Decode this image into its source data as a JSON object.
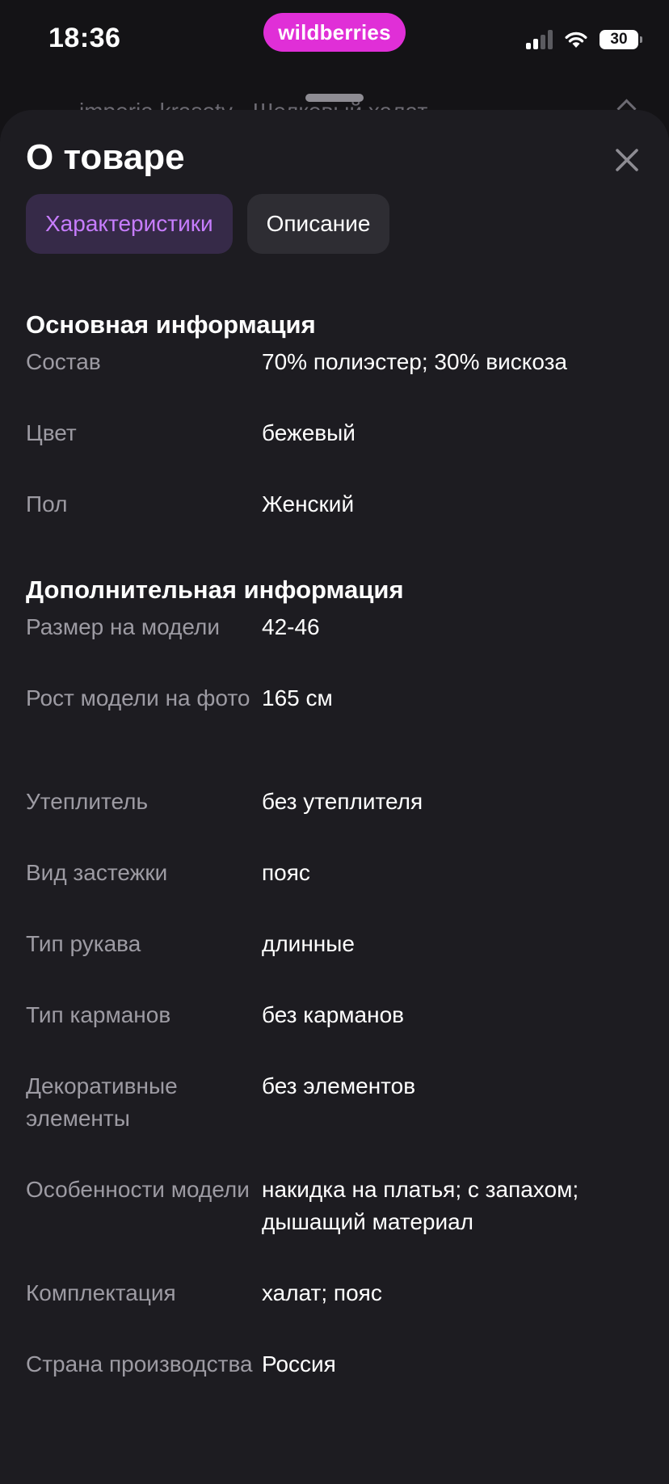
{
  "status_bar": {
    "time": "18:36",
    "brand": "wildberries",
    "battery": "30"
  },
  "background": {
    "title": "imperia krasoty · Шелковый халат"
  },
  "sheet": {
    "title": "О товаре",
    "tabs": [
      {
        "label": "Характеристики",
        "active": true
      },
      {
        "label": "Описание",
        "active": false
      }
    ],
    "sections": [
      {
        "title": "Основная информация",
        "rows": [
          {
            "label": "Состав",
            "value": "70% полиэстер; 30% вискоза"
          },
          {
            "label": "Цвет",
            "value": "бежевый"
          },
          {
            "label": "Пол",
            "value": "Женский"
          }
        ]
      },
      {
        "title": "Дополнительная информация",
        "rows": [
          {
            "label": "Размер на модели",
            "value": "42-46"
          },
          {
            "label": "Рост модели на фото",
            "value": "165 см"
          },
          {
            "label": "Утеплитель",
            "value": "без утеплителя"
          },
          {
            "label": "Вид застежки",
            "value": "пояс"
          },
          {
            "label": "Тип рукава",
            "value": "длинные"
          },
          {
            "label": "Тип карманов",
            "value": "без карманов"
          },
          {
            "label": "Декоративные элементы",
            "value": "без элементов"
          },
          {
            "label": "Особенности модели",
            "value": "накидка на платья; с запахом; дышащий материал"
          },
          {
            "label": "Комплектация",
            "value": "халат; пояс"
          },
          {
            "label": "Страна производства",
            "value": "Россия"
          }
        ]
      }
    ]
  },
  "colors": {
    "brand": "#e02fd7",
    "accent": "#c77dff",
    "sheet_background": "#1d1c21",
    "label_text": "#9d9ba3"
  },
  "icons": {
    "close": "close-icon",
    "signal": "cellular-signal-icon",
    "wifi": "wifi-icon",
    "battery": "battery-icon",
    "chevron": "chevron-up-icon"
  }
}
